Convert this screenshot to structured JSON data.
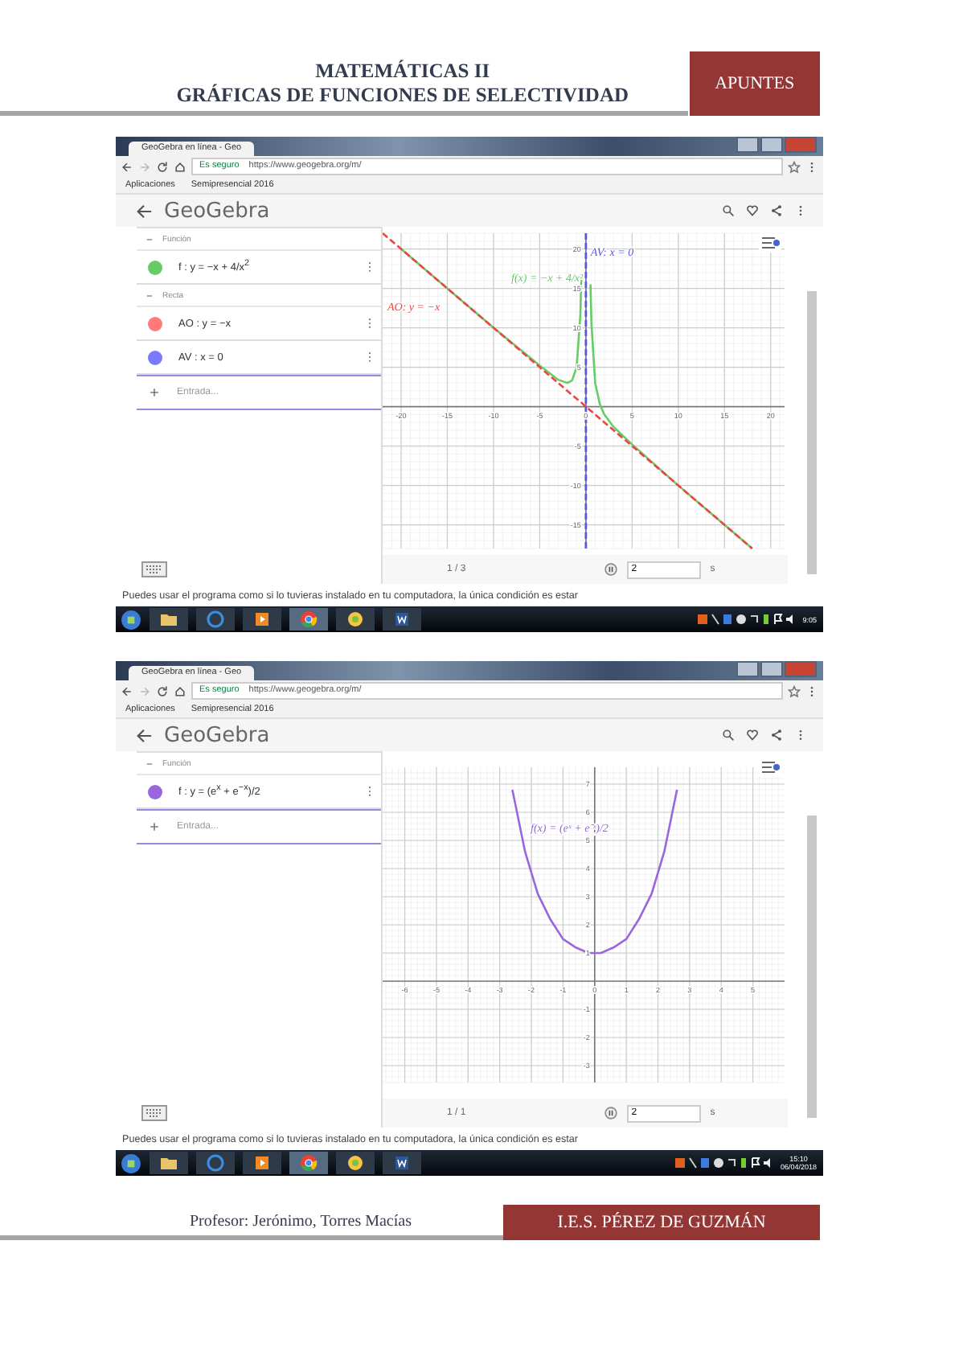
{
  "header": {
    "titles": [
      "MATEMÁTICAS II",
      "GRÁFICAS DE FUNCIONES DE SELECTIVIDAD"
    ],
    "badge": "APUNTES"
  },
  "screenshots": [
    {
      "browser": {
        "tab_title": "GeoGebra en línea - Geo",
        "security": "Es seguro",
        "url": "https://www.geogebra.org/m/",
        "bookmarks": [
          "Aplicaciones",
          "Semipresencial 2016"
        ]
      },
      "app_title": "GeoGebra",
      "algebra": [
        {
          "kind": "header",
          "label": "Función"
        },
        {
          "kind": "item",
          "color": "#66cc66",
          "formula": "f : y = −x + 4/x$^{2}$"
        },
        {
          "kind": "header",
          "label": "Recta"
        },
        {
          "kind": "item",
          "color": "#ff7a7a",
          "formula": "AO : y = −x"
        },
        {
          "kind": "item",
          "color": "#7a7aff",
          "formula": "AV : x = 0"
        },
        {
          "kind": "input",
          "placeholder": "Entrada..."
        }
      ],
      "chart_data": {
        "type": "line",
        "grid": true,
        "x": [
          -22,
          -20,
          -15,
          -10,
          -5,
          -3,
          -2,
          -1.5,
          -1,
          -0.6,
          -0.5,
          0,
          0.5,
          0.6,
          1,
          1.5,
          2,
          3,
          5,
          10,
          18
        ],
        "xlim": [
          -22,
          21.5
        ],
        "ylim": [
          -18,
          22
        ],
        "xticks": [
          -20,
          -15,
          -10,
          -5,
          0,
          5,
          10,
          15,
          20
        ],
        "yticks": [
          -15,
          -10,
          -5,
          5,
          10,
          15,
          20
        ],
        "series": [
          {
            "color": "#66cc66",
            "line_style": "solid",
            "values": [
              null,
              20,
              15,
              10,
              5.2,
              3.4,
              3,
              3.3,
              5,
              11.7,
              16.5,
              null,
              15.5,
              10.5,
              3,
              0.3,
              -1,
              -2.6,
              -4.8,
              -10,
              -18
            ]
          },
          {
            "color": "#ee4444",
            "line_style": "dashed",
            "values": [
              22,
              20,
              15,
              10,
              5,
              3,
              2,
              1.5,
              1,
              0.6,
              0.5,
              0,
              -0.5,
              -0.6,
              -1,
              -1.5,
              -2,
              -3,
              -5,
              -10,
              -18
            ]
          }
        ],
        "ref_lines": [
          {
            "axis": "x",
            "value": 0,
            "label": "AV: x = 0",
            "color": "#5555ee",
            "line_style": "dashed"
          }
        ],
        "annotations": [
          "f(x) = −x + 4/x²",
          "AO: y = −x"
        ]
      },
      "nav": {
        "page": "1 / 3",
        "speed": "2",
        "unit": "s"
      },
      "caption": "Puedes usar el programa como si lo tuvieras instalado en tu computadora, la única condición es estar",
      "clock": {
        "time": "9:05"
      }
    },
    {
      "browser": {
        "tab_title": "GeoGebra en línea - Geo",
        "security": "Es seguro",
        "url": "https://www.geogebra.org/m/",
        "bookmarks": [
          "Aplicaciones",
          "Semipresencial 2016"
        ]
      },
      "app_title": "GeoGebra",
      "algebra": [
        {
          "kind": "header",
          "label": "Función"
        },
        {
          "kind": "item",
          "color": "#9966dd",
          "formula": "f : y = (e$^{x}$ + e$^{−x}$)/2"
        },
        {
          "kind": "input",
          "placeholder": "Entrada..."
        }
      ],
      "chart_data": {
        "type": "line",
        "grid": true,
        "x": [
          -2.6,
          -2.2,
          -1.8,
          -1.4,
          -1,
          -0.6,
          -0.2,
          0,
          0.2,
          0.6,
          1,
          1.4,
          1.8,
          2.2,
          2.6
        ],
        "xlim": [
          -6.7,
          6
        ],
        "ylim": [
          -3.6,
          7.6
        ],
        "xticks": [
          -6,
          -5,
          -4,
          -3,
          -2,
          -1,
          0,
          1,
          2,
          3,
          4,
          5
        ],
        "yticks": [
          -3,
          -2,
          -1,
          1,
          2,
          3,
          4,
          5,
          6,
          7
        ],
        "series": [
          {
            "color": "#9966dd",
            "line_style": "solid",
            "values": [
              6.8,
              4.6,
              3.1,
              2.2,
              1.5,
              1.2,
              1,
              1,
              1,
              1.2,
              1.5,
              2.2,
              3.1,
              4.6,
              6.8
            ]
          }
        ],
        "annotations": [
          "f(x) = (eˣ + e⁻ˣ)/2"
        ]
      },
      "nav": {
        "page": "1 / 1",
        "speed": "2",
        "unit": "s"
      },
      "caption": "Puedes usar el programa como si lo tuvieras instalado en tu computadora, la única condición es estar",
      "clock": {
        "time": "15:10",
        "date": "06/04/2018"
      }
    }
  ],
  "footer": {
    "author": "Profesor: Jerónimo, Torres Macías",
    "school": "I.E.S. PÉREZ DE GUZMÁN"
  }
}
